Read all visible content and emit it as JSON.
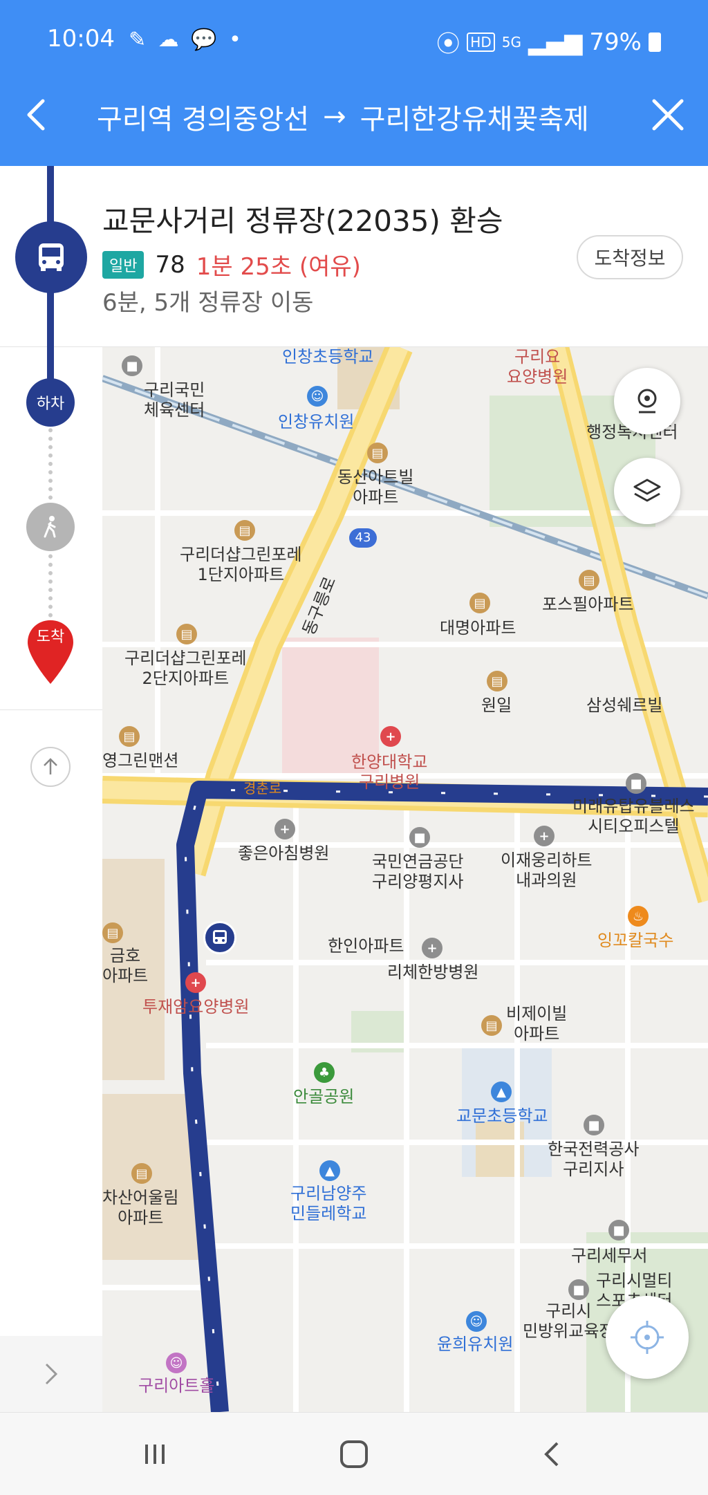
{
  "status_bar": {
    "time": "10:04",
    "battery": "79%",
    "network": "5G",
    "hd": "HD"
  },
  "header": {
    "origin": "구리역 경의중앙선",
    "arrow": "→",
    "destination": "구리한강유채꽃축제"
  },
  "step": {
    "title": "교문사거리 정류장(22035) 환승",
    "bus_type": "일반",
    "bus_number": "78",
    "eta": "1분 25초 (여유)",
    "summary": "6분, 5개 정류장 이동",
    "arrival_button": "도착정보"
  },
  "rail": {
    "alight_label": "하차",
    "arrive_label": "도착"
  },
  "map": {
    "labels": {
      "inchang_elem": "인창초등학교",
      "guri_elder": "구리요\n요양병원",
      "guri_gym": "구리국민\n체육센터",
      "inchang_kinder": "인창유치원",
      "inchang_admin": "인창\n행정복지센터",
      "dongsan_apt": "동산아트빌\n아파트",
      "deoshap1": "구리더샵그린포레\n1단지아파트",
      "posfeel": "포스필아파트",
      "daemyung": "대명아파트",
      "deoshap2": "구리더샵그린포레\n2단지아파트",
      "wonil": "원일",
      "samsung_shell": "삼성쉐르빌",
      "young_green": "영그린맨션",
      "hanyang_hosp": "한양대학교\n구리병원",
      "gyeongchun_ro": "경춘로",
      "mirae": "미래유탑유블레스\n시티오피스텔",
      "good_morning": "좋은아침병원",
      "nps": "국민연금공단\n구리양평지사",
      "lee_clinic": "이재웅리하트\n내과의원",
      "ingo": "잉꼬칼국수",
      "geumho": "금호\n아파트",
      "hanin": "한인아파트",
      "riche": "리체한방병원",
      "tujae": "투재암요양병원",
      "bjeil": "비제이빌\n아파트",
      "angol_park": "안골공원",
      "gyomun_elem": "교문초등학교",
      "kepco": "한국전력공사\n구리지사",
      "chasan": "차산어울림\n아파트",
      "minde_school": "구리남양주\n민들레학교",
      "guri_tax": "구리세무서",
      "guri_hall": "구리시멀티\n스포츠센터",
      "yunhee": "윤희유치원",
      "guri_civil": "구리시\n민방위교육장",
      "guri_art": "구리아트홀",
      "road_43": "43",
      "boulevard": "동구릉로",
      "guri_short": "구리"
    }
  }
}
